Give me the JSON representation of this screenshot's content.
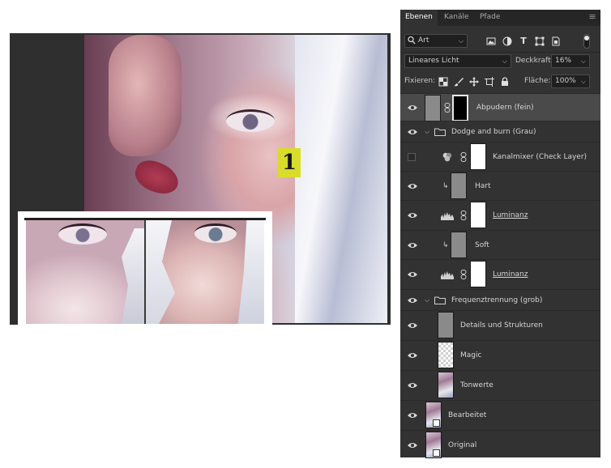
{
  "canvas": {
    "badge_label": "1"
  },
  "panel": {
    "tabs": [
      {
        "label": "Ebenen",
        "active": true
      },
      {
        "label": "Kanäle",
        "active": false
      },
      {
        "label": "Pfade",
        "active": false
      }
    ],
    "menu_icon": "hamburger-icon",
    "filter": {
      "value": "Art",
      "icon": "search-icon"
    },
    "blend_mode": "Lineares Licht",
    "opacity_label": "Deckkraft:",
    "opacity_value": "16%",
    "lock_label": "Fixieren:",
    "fill_label": "Fläche:",
    "fill_value": "100%",
    "filter_icons": [
      "image-filter-icon",
      "adjustment-filter-icon",
      "type-filter-icon",
      "shape-filter-icon",
      "smart-object-filter-icon"
    ],
    "lock_icons": [
      "lock-transparent-icon",
      "lock-paint-icon",
      "lock-position-icon",
      "lock-artboard-icon",
      "lock-all-icon"
    ]
  },
  "layers": [
    {
      "name": "Abpudern (fein)",
      "visible": true,
      "selected": true,
      "thumb": "gray",
      "mask": "black"
    },
    {
      "name": "Dodge and burn (Grau)",
      "visible": true,
      "group": true
    },
    {
      "name": "Kanalmixer (Check Layer)",
      "visible": false,
      "adjustment": "channel-mixer-icon",
      "mask": "white"
    },
    {
      "name": "Hart",
      "visible": true,
      "clipped": true,
      "thumb": "gray"
    },
    {
      "name": "Luminanz",
      "visible": true,
      "adjustment": "levels-icon",
      "mask": "white",
      "underline": true
    },
    {
      "name": "Soft",
      "visible": true,
      "clipped": true,
      "thumb": "gray"
    },
    {
      "name": "Luminanz",
      "visible": true,
      "adjustment": "levels-icon",
      "mask": "white",
      "underline": true
    },
    {
      "name": "Frequenztrennung (grob)",
      "visible": true,
      "group": true
    },
    {
      "name": "Details und Strukturen",
      "visible": true,
      "thumb": "gray"
    },
    {
      "name": "Magic",
      "visible": true,
      "thumb": "checker"
    },
    {
      "name": "Tonwerte",
      "visible": true,
      "thumb": "photo"
    },
    {
      "name": "Bearbeitet",
      "visible": true,
      "thumb": "photo-smart"
    },
    {
      "name": "Original",
      "visible": true,
      "thumb": "photo-smart"
    }
  ]
}
